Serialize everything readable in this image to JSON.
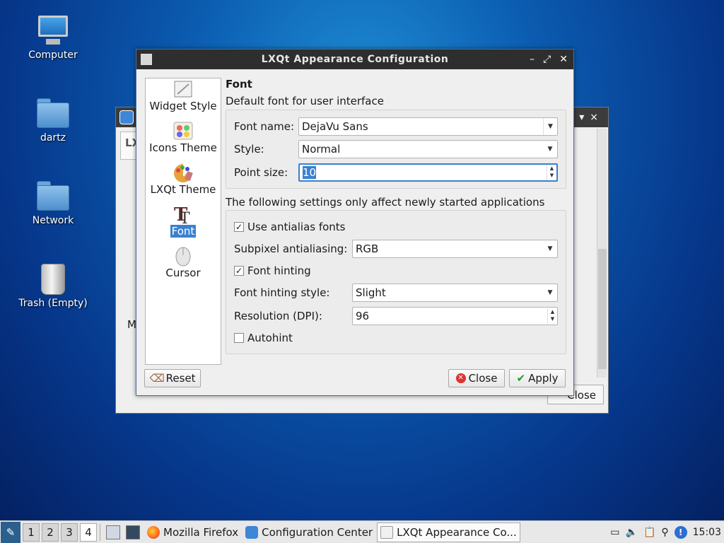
{
  "desktop": {
    "icons": [
      {
        "label": "Computer",
        "icon": "computer-icon"
      },
      {
        "label": "dartz",
        "icon": "home-folder-icon"
      },
      {
        "label": "Network",
        "icon": "network-folder-icon"
      },
      {
        "label": "Trash (Empty)",
        "icon": "trash-icon"
      }
    ]
  },
  "bg_window": {
    "panel_text": "LX",
    "partial_label": "M",
    "close_label": "Close"
  },
  "dialog": {
    "title": "LXQt Appearance Configuration",
    "title_buttons": [
      "minimize",
      "maximize",
      "close"
    ],
    "sidebar": [
      {
        "label": "Widget Style",
        "icon": "widget-style-icon"
      },
      {
        "label": "Icons Theme",
        "icon": "icons-theme-icon"
      },
      {
        "label": "LXQt Theme",
        "icon": "lxqt-theme-icon"
      },
      {
        "label": "Font",
        "icon": "font-icon",
        "active": true
      },
      {
        "label": "Cursor",
        "icon": "cursor-icon"
      }
    ],
    "section_title": "Font",
    "default_font_heading": "Default font for user interface",
    "font_name_label": "Font name:",
    "font_name_value": "DejaVu Sans",
    "style_label": "Style:",
    "style_value": "Normal",
    "point_size_label": "Point size:",
    "point_size_value": "10",
    "new_apps_heading": "The following settings only affect newly started applications",
    "antialias_label": "Use antialias fonts",
    "antialias_checked": true,
    "subpixel_label": "Subpixel antialiasing:",
    "subpixel_value": "RGB",
    "hinting_label": "Font hinting",
    "hinting_checked": true,
    "hinting_style_label": "Font hinting style:",
    "hinting_style_value": "Slight",
    "dpi_label": "Resolution (DPI):",
    "dpi_value": "96",
    "autohint_label": "Autohint",
    "autohint_checked": false,
    "reset_label": "Reset",
    "close_label": "Close",
    "apply_label": "Apply"
  },
  "taskbar": {
    "workspaces": [
      "1",
      "2",
      "3",
      "4"
    ],
    "current_workspace": "4",
    "tasks": [
      {
        "label": "Mozilla Firefox",
        "icon": "firefox-icon"
      },
      {
        "label": "Configuration Center",
        "icon": "config-center-icon"
      },
      {
        "label": "LXQt Appearance Co...",
        "icon": "appearance-icon",
        "active": true
      }
    ],
    "clock": "15:03"
  },
  "colors": {
    "accent": "#3a80d0",
    "titlebar": "#2e2e2e",
    "desktop_blue": "#0b5cb0"
  }
}
